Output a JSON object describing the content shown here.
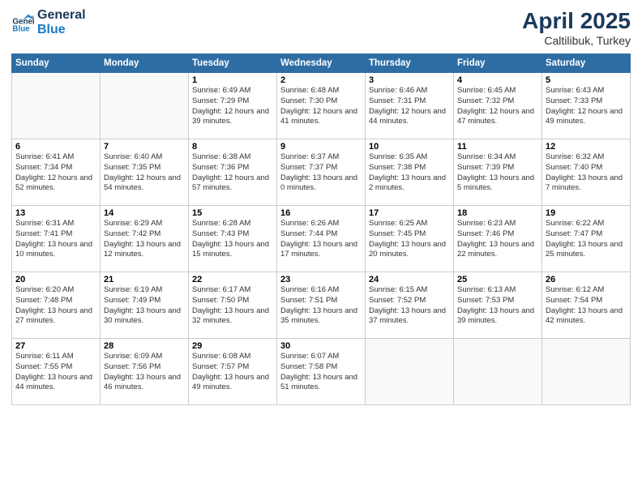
{
  "header": {
    "logo_line1": "General",
    "logo_line2": "Blue",
    "month_year": "April 2025",
    "location": "Caltilibuk, Turkey"
  },
  "days_of_week": [
    "Sunday",
    "Monday",
    "Tuesday",
    "Wednesday",
    "Thursday",
    "Friday",
    "Saturday"
  ],
  "weeks": [
    [
      {
        "day": "",
        "info": ""
      },
      {
        "day": "",
        "info": ""
      },
      {
        "day": "1",
        "info": "Sunrise: 6:49 AM\nSunset: 7:29 PM\nDaylight: 12 hours and 39 minutes."
      },
      {
        "day": "2",
        "info": "Sunrise: 6:48 AM\nSunset: 7:30 PM\nDaylight: 12 hours and 41 minutes."
      },
      {
        "day": "3",
        "info": "Sunrise: 6:46 AM\nSunset: 7:31 PM\nDaylight: 12 hours and 44 minutes."
      },
      {
        "day": "4",
        "info": "Sunrise: 6:45 AM\nSunset: 7:32 PM\nDaylight: 12 hours and 47 minutes."
      },
      {
        "day": "5",
        "info": "Sunrise: 6:43 AM\nSunset: 7:33 PM\nDaylight: 12 hours and 49 minutes."
      }
    ],
    [
      {
        "day": "6",
        "info": "Sunrise: 6:41 AM\nSunset: 7:34 PM\nDaylight: 12 hours and 52 minutes."
      },
      {
        "day": "7",
        "info": "Sunrise: 6:40 AM\nSunset: 7:35 PM\nDaylight: 12 hours and 54 minutes."
      },
      {
        "day": "8",
        "info": "Sunrise: 6:38 AM\nSunset: 7:36 PM\nDaylight: 12 hours and 57 minutes."
      },
      {
        "day": "9",
        "info": "Sunrise: 6:37 AM\nSunset: 7:37 PM\nDaylight: 13 hours and 0 minutes."
      },
      {
        "day": "10",
        "info": "Sunrise: 6:35 AM\nSunset: 7:38 PM\nDaylight: 13 hours and 2 minutes."
      },
      {
        "day": "11",
        "info": "Sunrise: 6:34 AM\nSunset: 7:39 PM\nDaylight: 13 hours and 5 minutes."
      },
      {
        "day": "12",
        "info": "Sunrise: 6:32 AM\nSunset: 7:40 PM\nDaylight: 13 hours and 7 minutes."
      }
    ],
    [
      {
        "day": "13",
        "info": "Sunrise: 6:31 AM\nSunset: 7:41 PM\nDaylight: 13 hours and 10 minutes."
      },
      {
        "day": "14",
        "info": "Sunrise: 6:29 AM\nSunset: 7:42 PM\nDaylight: 13 hours and 12 minutes."
      },
      {
        "day": "15",
        "info": "Sunrise: 6:28 AM\nSunset: 7:43 PM\nDaylight: 13 hours and 15 minutes."
      },
      {
        "day": "16",
        "info": "Sunrise: 6:26 AM\nSunset: 7:44 PM\nDaylight: 13 hours and 17 minutes."
      },
      {
        "day": "17",
        "info": "Sunrise: 6:25 AM\nSunset: 7:45 PM\nDaylight: 13 hours and 20 minutes."
      },
      {
        "day": "18",
        "info": "Sunrise: 6:23 AM\nSunset: 7:46 PM\nDaylight: 13 hours and 22 minutes."
      },
      {
        "day": "19",
        "info": "Sunrise: 6:22 AM\nSunset: 7:47 PM\nDaylight: 13 hours and 25 minutes."
      }
    ],
    [
      {
        "day": "20",
        "info": "Sunrise: 6:20 AM\nSunset: 7:48 PM\nDaylight: 13 hours and 27 minutes."
      },
      {
        "day": "21",
        "info": "Sunrise: 6:19 AM\nSunset: 7:49 PM\nDaylight: 13 hours and 30 minutes."
      },
      {
        "day": "22",
        "info": "Sunrise: 6:17 AM\nSunset: 7:50 PM\nDaylight: 13 hours and 32 minutes."
      },
      {
        "day": "23",
        "info": "Sunrise: 6:16 AM\nSunset: 7:51 PM\nDaylight: 13 hours and 35 minutes."
      },
      {
        "day": "24",
        "info": "Sunrise: 6:15 AM\nSunset: 7:52 PM\nDaylight: 13 hours and 37 minutes."
      },
      {
        "day": "25",
        "info": "Sunrise: 6:13 AM\nSunset: 7:53 PM\nDaylight: 13 hours and 39 minutes."
      },
      {
        "day": "26",
        "info": "Sunrise: 6:12 AM\nSunset: 7:54 PM\nDaylight: 13 hours and 42 minutes."
      }
    ],
    [
      {
        "day": "27",
        "info": "Sunrise: 6:11 AM\nSunset: 7:55 PM\nDaylight: 13 hours and 44 minutes."
      },
      {
        "day": "28",
        "info": "Sunrise: 6:09 AM\nSunset: 7:56 PM\nDaylight: 13 hours and 46 minutes."
      },
      {
        "day": "29",
        "info": "Sunrise: 6:08 AM\nSunset: 7:57 PM\nDaylight: 13 hours and 49 minutes."
      },
      {
        "day": "30",
        "info": "Sunrise: 6:07 AM\nSunset: 7:58 PM\nDaylight: 13 hours and 51 minutes."
      },
      {
        "day": "",
        "info": ""
      },
      {
        "day": "",
        "info": ""
      },
      {
        "day": "",
        "info": ""
      }
    ]
  ]
}
